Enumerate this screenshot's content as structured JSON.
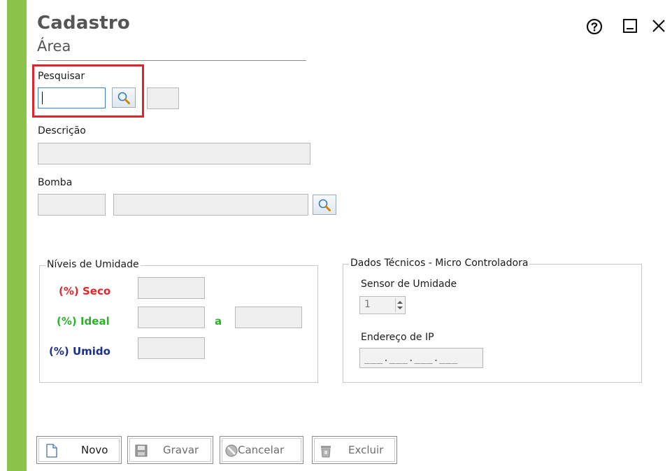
{
  "window": {
    "title": "Cadastro",
    "subtitle": "Área",
    "icons": [
      "help-icon",
      "minimize-icon",
      "close-icon"
    ]
  },
  "colors": {
    "accent": "#8bc34a",
    "highlight": "#e0242b",
    "seco": "#e8232a",
    "ideal": "#2bb32b",
    "umido": "#1c2f8c"
  },
  "search": {
    "label": "Pesquisar",
    "value": ""
  },
  "descricao": {
    "label": "Descrição",
    "value": ""
  },
  "bomba": {
    "label": "Bomba",
    "code": "",
    "name": ""
  },
  "umidade": {
    "legend": "Níveis de Umidade",
    "seco_label": "(%) Seco",
    "ideal_label": "(%) Ideal",
    "range_sep": "a",
    "umido_label": "(%) Umido"
  },
  "tecnicos": {
    "legend": "Dados Técnicos - Micro Controladora",
    "sensor_label": "Sensor de Umidade",
    "sensor_value": "1",
    "ip_label": "Endereço de IP",
    "ip_mask": "___.___.___.___"
  },
  "buttons": {
    "novo": "Novo",
    "gravar": "Gravar",
    "cancelar": "Cancelar",
    "excluir": "Excluir"
  }
}
